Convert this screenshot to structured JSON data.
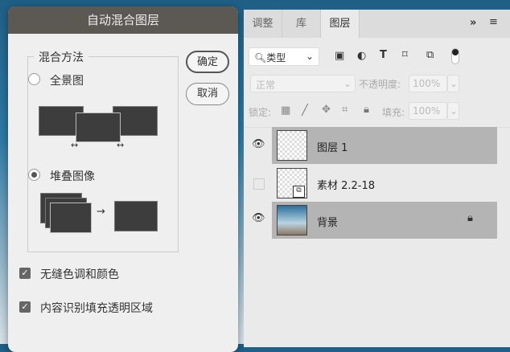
{
  "dialog": {
    "title": "自动混合图层",
    "group_label": "混合方法",
    "options": [
      {
        "label": "全景图",
        "selected": false
      },
      {
        "label": "堆叠图像",
        "selected": true
      }
    ],
    "ok": "确定",
    "cancel": "取消",
    "checkboxes": [
      {
        "label": "无缝色调和颜色",
        "checked": true
      },
      {
        "label": "内容识别填充透明区域",
        "checked": true
      }
    ]
  },
  "panel": {
    "tabs": [
      "调整",
      "库",
      "图层"
    ],
    "active_tab": "图层",
    "more": "»",
    "filter_label": "类型",
    "blend_mode": "正常",
    "opacity_label": "不透明度:",
    "opacity": "100%",
    "lock_label": "锁定:",
    "fill_label": "填充:",
    "fill": "100%",
    "layers": [
      {
        "name": "图层 1",
        "visible": true,
        "selected": true
      },
      {
        "name": "素材 2.2-18",
        "visible": false,
        "selected": false
      },
      {
        "name": "背景",
        "visible": true,
        "selected": true,
        "locked": true
      }
    ]
  }
}
